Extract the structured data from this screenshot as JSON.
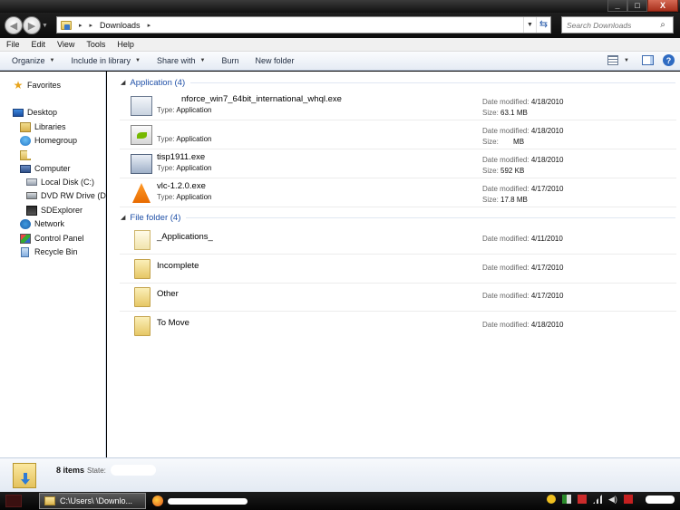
{
  "window": {
    "caption_buttons": [
      "_",
      "□",
      "X"
    ]
  },
  "address": {
    "crumb_separator": "▸",
    "current_folder": "Downloads",
    "search_placeholder": "Search Downloads"
  },
  "menu": [
    "File",
    "Edit",
    "View",
    "Tools",
    "Help"
  ],
  "commands": {
    "organize": "Organize",
    "include_in_library": "Include in library",
    "share_with": "Share with",
    "burn": "Burn",
    "new_folder": "New folder"
  },
  "nav": {
    "favorites": "Favorites",
    "desktop": "Desktop",
    "libraries": "Libraries",
    "homegroup": "Homegroup",
    "computer": "Computer",
    "local_disk": "Local Disk (C:)",
    "dvd_drive": "DVD RW Drive (D:)",
    "sdexplorer": "SDExplorer",
    "network": "Network",
    "control_panel": "Control Panel",
    "recycle_bin": "Recycle Bin"
  },
  "groups": {
    "application": "Application (4)",
    "file_folder": "File folder (4)"
  },
  "labels": {
    "type": "Type:",
    "date_modified": "Date modified:",
    "size": "Size:"
  },
  "applications": [
    {
      "name": "nforce_win7_64bit_international_whql.exe",
      "type": "Application",
      "date": "4/18/2010",
      "size": "63.1 MB",
      "icon": "application-installer-icon"
    },
    {
      "name": "",
      "type": "Application",
      "date": "4/18/2010",
      "size": "MB",
      "icon": "nvidia-icon"
    },
    {
      "name": "tisp1911.exe",
      "type": "Application",
      "date": "4/18/2010",
      "size": "592 KB",
      "icon": "tisp-installer-icon"
    },
    {
      "name": "vlc-1.2.0.exe",
      "type": "Application",
      "date": "4/17/2010",
      "size": "17.8 MB",
      "icon": "vlc-cone-icon"
    }
  ],
  "folders": [
    {
      "name": "_Applications_",
      "date": "4/11/2010"
    },
    {
      "name": "Incomplete",
      "date": "4/17/2010"
    },
    {
      "name": "Other",
      "date": "4/17/2010"
    },
    {
      "name": "To Move",
      "date": "4/18/2010"
    }
  ],
  "details": {
    "count": "8 items",
    "state_label": "State:"
  },
  "taskbar": {
    "explorer_task": "C:\\Users\\      \\Downlo..."
  }
}
